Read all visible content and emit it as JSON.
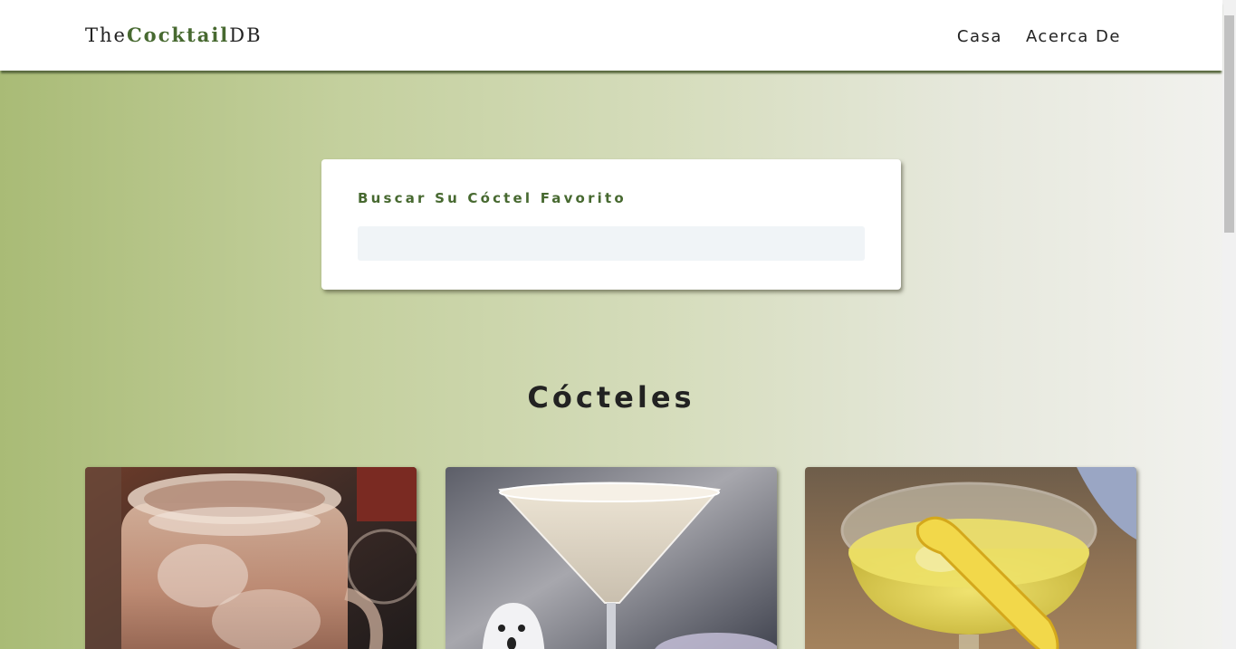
{
  "navbar": {
    "brand_prefix": "The",
    "brand_accent": "Cocktail",
    "brand_suffix": "DB",
    "links": [
      {
        "label": "Casa"
      },
      {
        "label": "Acerca De"
      }
    ]
  },
  "search": {
    "label": "Buscar Su Cóctel Favorito",
    "value": ""
  },
  "section": {
    "title": "Cócteles"
  },
  "cocktails": [
    {
      "image_icon": "cocktail-mason-jar-photo"
    },
    {
      "image_icon": "cocktail-martini-glass-photo"
    },
    {
      "image_icon": "cocktail-coupe-lemon-photo"
    }
  ],
  "colors": {
    "accent": "#476930",
    "navbar_shadow": "#59693f",
    "gradient_start": "#a9bb76",
    "gradient_end": "#f2f2ef",
    "input_bg": "#f0f4f7"
  }
}
